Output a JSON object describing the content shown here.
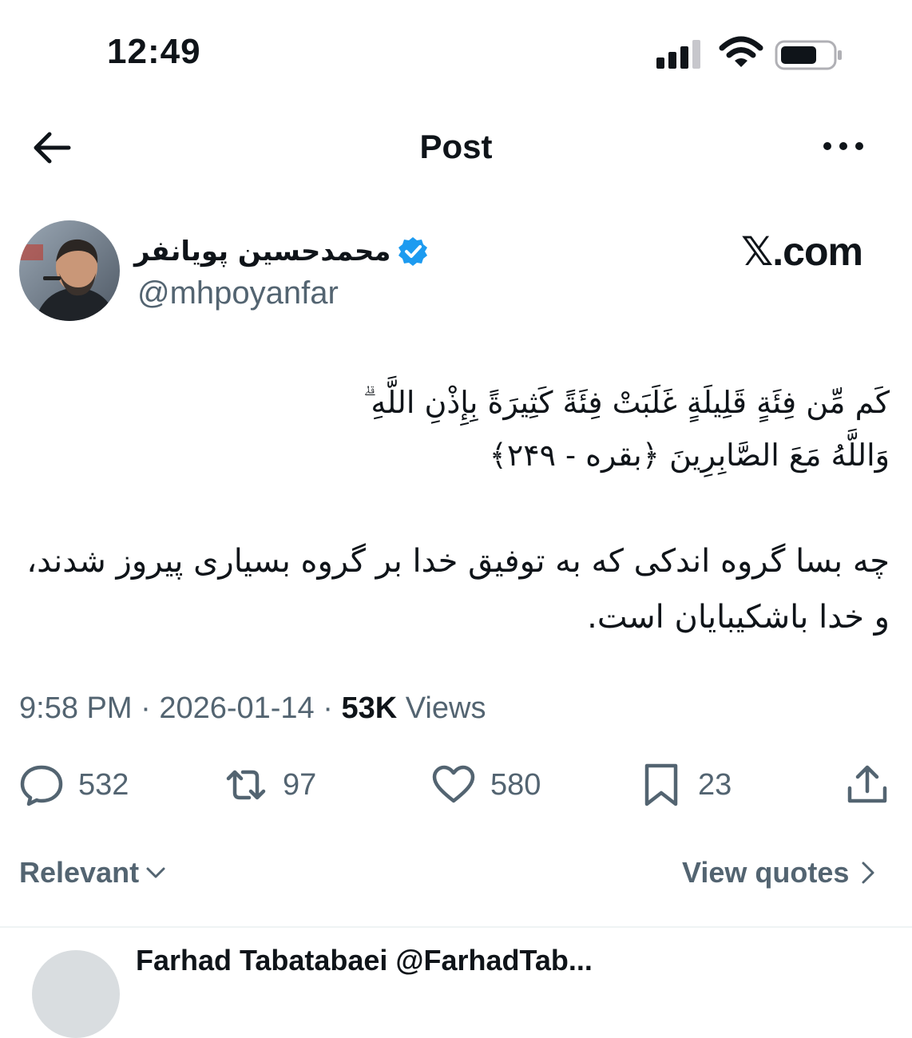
{
  "status_bar": {
    "time": "12:49"
  },
  "header": {
    "title": "Post"
  },
  "author": {
    "name": "محمدحسین پویانفر",
    "handle": "@mhpoyanfar"
  },
  "watermark": "𝕏.com",
  "post": {
    "arabic_line1": "كَم مِّن فِئَةٍ قَلِيلَةٍ غَلَبَتْ فِئَةً كَثِيرَةً بِإِذْنِ اللَّهِ ۗ",
    "arabic_line2": "وَاللَّهُ مَعَ الصَّابِرِينَ ﴿بقره - ۲۴۹﴾",
    "persian_text": "چه بسا گروه اندکی که به توفیق خدا بر گروه بسیاری پیروز شدند، و خدا باشکیبایان است."
  },
  "meta": {
    "time": "9:58 PM",
    "sep1": "·",
    "date": "2026-01-14",
    "sep2": "·",
    "views_count": "53K",
    "views_label": "Views"
  },
  "actions": {
    "replies": "532",
    "reposts": "97",
    "likes": "580",
    "bookmarks": "23"
  },
  "footer": {
    "sort_label": "Relevant",
    "view_quotes": "View quotes"
  },
  "next_reply": {
    "name_partial": "Farhad Tabatabaei @FarhadTab..."
  },
  "colors": {
    "text": "#0f1419",
    "secondary": "#536471",
    "verified": "#1d9bf0"
  }
}
